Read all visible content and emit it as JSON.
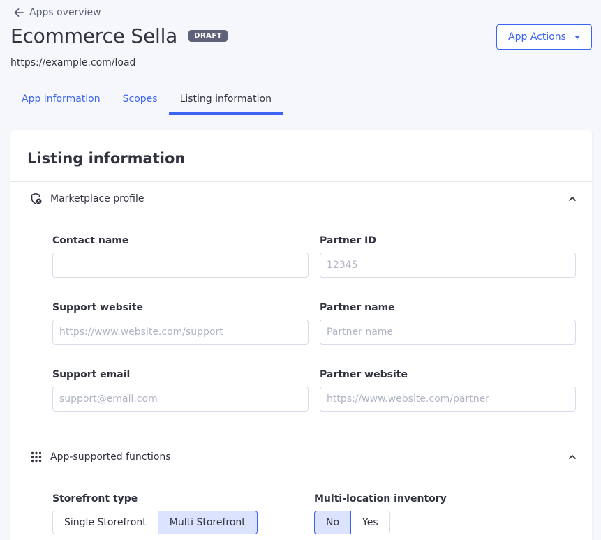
{
  "header": {
    "back_label": "Apps overview",
    "title": "Ecommerce Sella",
    "badge": "DRAFT",
    "url": "https://example.com/load",
    "actions_label": "App Actions"
  },
  "tabs": [
    {
      "label": "App information",
      "active": false
    },
    {
      "label": "Scopes",
      "active": false
    },
    {
      "label": "Listing information",
      "active": true
    }
  ],
  "card": {
    "title": "Listing information"
  },
  "marketplace_profile": {
    "label": "Marketplace profile",
    "fields": {
      "contact_name": {
        "label": "Contact name",
        "value": "",
        "placeholder": ""
      },
      "partner_id": {
        "label": "Partner ID",
        "value": "",
        "placeholder": "12345"
      },
      "support_website": {
        "label": "Support website",
        "value": "",
        "placeholder": "https://www.website.com/support"
      },
      "partner_name": {
        "label": "Partner name",
        "value": "",
        "placeholder": "Partner name"
      },
      "support_email": {
        "label": "Support email",
        "value": "",
        "placeholder": "support@email.com"
      },
      "partner_website": {
        "label": "Partner website",
        "value": "",
        "placeholder": "https://www.website.com/partner"
      }
    }
  },
  "supported_functions": {
    "label": "App-supported functions",
    "storefront": {
      "label": "Storefront type",
      "options": [
        "Single Storefront",
        "Multi Storefront"
      ],
      "selected": "Multi Storefront"
    },
    "multi_location": {
      "label": "Multi-location inventory",
      "options": [
        "No",
        "Yes"
      ],
      "selected": "No"
    }
  },
  "colors": {
    "accent": "#3c64f4",
    "selected_bg": "#dbe3fe",
    "badge_bg": "#5e637a",
    "text": "#313440"
  }
}
